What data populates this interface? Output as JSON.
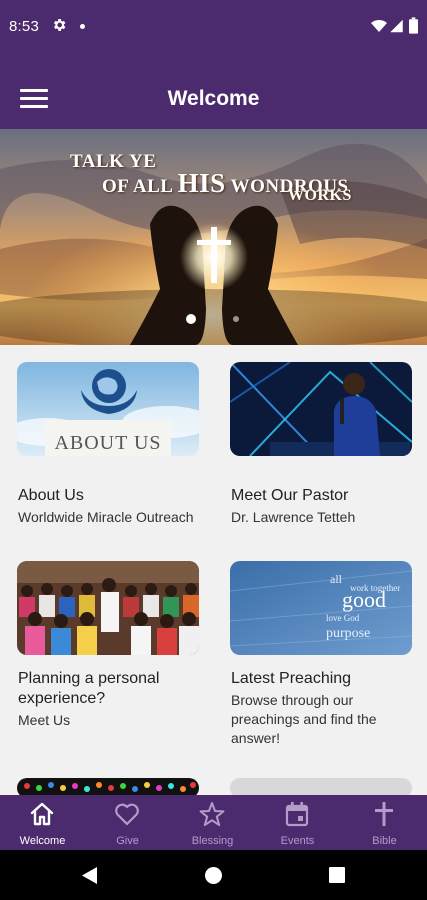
{
  "status_bar": {
    "time": "8:53",
    "icons": [
      "gear-icon",
      "notification-dot",
      "wifi-icon",
      "signal-icon",
      "battery-icon"
    ]
  },
  "app_bar": {
    "title": "Welcome",
    "menu_icon": "hamburger-menu-icon"
  },
  "banner": {
    "line1": "TALK YE",
    "line2_pre": "OF ALL ",
    "line2_his": "HIS",
    "line2_post": " WONDROUS",
    "line3": "WORKS",
    "slides_total": 2,
    "active_slide": 1
  },
  "cards": [
    {
      "title": "About Us",
      "subtitle": "Worldwide Miracle Outreach",
      "image_text": "ABOUT US"
    },
    {
      "title": "Meet Our Pastor",
      "subtitle": "Dr. Lawrence Tetteh"
    },
    {
      "title": "Planning a personal experience?",
      "subtitle": "Meet Us"
    },
    {
      "title": "Latest Preaching",
      "subtitle": "Browse through our preachings and find the answer!",
      "image_text": "good"
    }
  ],
  "bottom_nav": {
    "items": [
      {
        "label": "Welcome",
        "icon": "home-icon",
        "active": true
      },
      {
        "label": "Give",
        "icon": "heart-icon",
        "active": false
      },
      {
        "label": "Blessing",
        "icon": "star-icon",
        "active": false
      },
      {
        "label": "Events",
        "icon": "calendar-icon",
        "active": false
      },
      {
        "label": "Bible",
        "icon": "cross-icon",
        "active": false
      }
    ]
  },
  "colors": {
    "primary": "#4b2a6e",
    "background": "#f1f1f2",
    "nav_inactive": "#b49cc9"
  }
}
